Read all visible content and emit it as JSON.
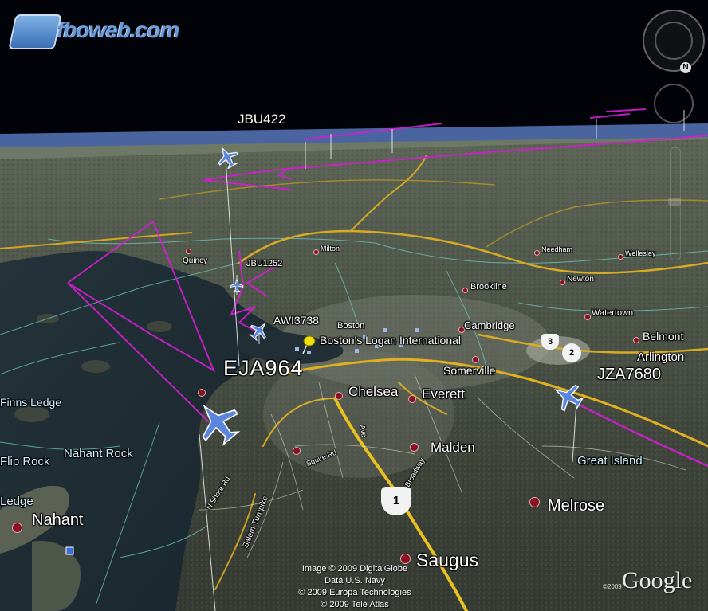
{
  "logo": {
    "text": "fboweb.com"
  },
  "navigation": {
    "north_label": "N"
  },
  "flights": [
    {
      "callsign": "JBU422"
    },
    {
      "callsign": "JBU1252"
    },
    {
      "callsign": "AWI3738"
    },
    {
      "callsign": "EJA964"
    },
    {
      "callsign": "JZA7680"
    }
  ],
  "places": {
    "milton": "Milton",
    "quincy": "Quincy",
    "needham": "Needham",
    "wellesley": "Wellesley",
    "brookline": "Brookline",
    "newton": "Newton",
    "watertown": "Watertown",
    "boston": "Boston",
    "cambridge": "Cambridge",
    "belmont": "Belmont",
    "arlington": "Arlington",
    "airport": "Boston's Logan International",
    "somerville": "Somerville",
    "chelsea": "Chelsea",
    "everett": "Everett",
    "malden": "Malden",
    "melrose": "Melrose",
    "saugus": "Saugus",
    "nahant": "Nahant",
    "great_island": "Great Island",
    "finns_ledge": "Finns Ledge",
    "flip_rock": "Flip Rock",
    "nahant_rock": "Nahant Rock",
    "ledge": "Ledge"
  },
  "roads": {
    "squire_rd": "Squire Rd",
    "salem_turnpike": "Salem Turnpike",
    "n_shore_rd": "N Shore Rd",
    "broadway": "Broadway",
    "ave": "Ave"
  },
  "route_shields": [
    "1",
    "3",
    "2"
  ],
  "credits": [
    "Image © 2009 DigitalGlobe",
    "Data U.S. Navy",
    "© 2009 Europa Technologies",
    "© 2009 Tele Atlas"
  ],
  "google": {
    "brand": "Google",
    "year": "©2009"
  },
  "colors": {
    "flight_track": "#d21fd2",
    "highway": "#e0b020",
    "boundary": "#6fc6c0",
    "aircraft": "#5b86e0"
  }
}
